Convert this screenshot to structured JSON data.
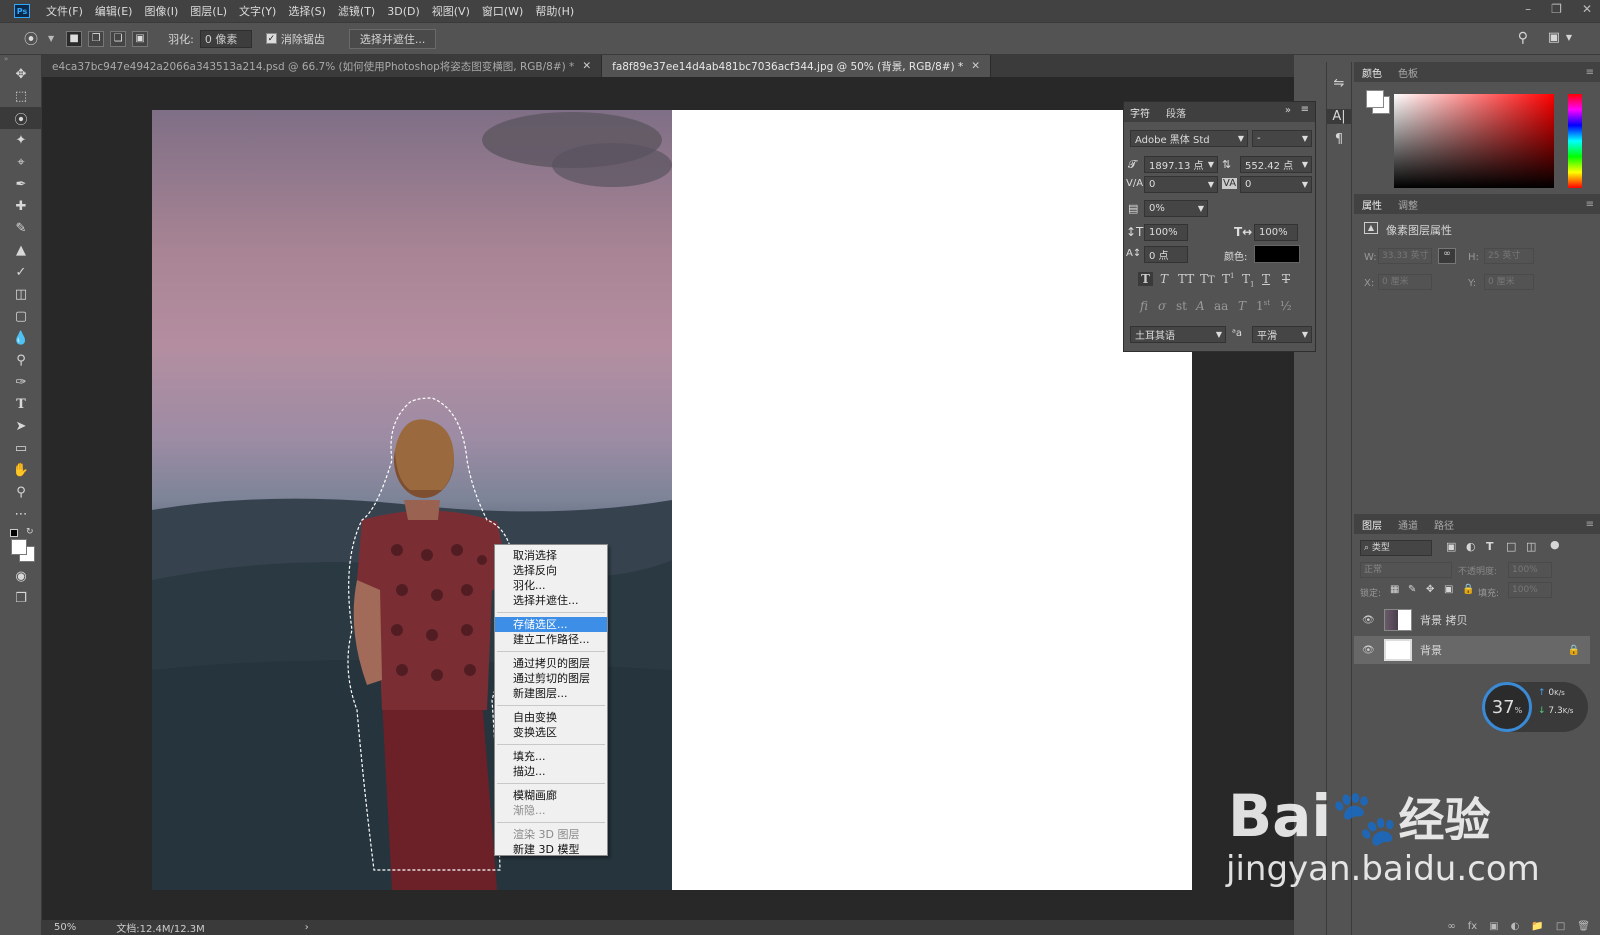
{
  "app": {
    "logo": "Ps"
  },
  "menu": [
    "文件(F)",
    "编辑(E)",
    "图像(I)",
    "图层(L)",
    "文字(Y)",
    "选择(S)",
    "滤镜(T)",
    "3D(D)",
    "视图(V)",
    "窗口(W)",
    "帮助(H)"
  ],
  "options": {
    "feather_label": "羽化:",
    "feather_value": "0 像素",
    "antialias_label": "消除锯齿",
    "antialias_checked": true,
    "select_mask_button": "选择并遮住..."
  },
  "tabs": [
    {
      "title": "e4ca37bc947e4942a2066a343513a214.psd @ 66.7% (如何使用Photoshop将姿态图变横图, RGB/8#) *",
      "active": false
    },
    {
      "title": "fa8f89e37ee14d4ab481bc7036acf344.jpg @ 50% (背景, RGB/8#) *",
      "active": true
    }
  ],
  "context_menu": [
    {
      "label": "取消选择",
      "state": "normal"
    },
    {
      "label": "选择反向",
      "state": "normal"
    },
    {
      "label": "羽化...",
      "state": "normal"
    },
    {
      "label": "选择并遮住...",
      "state": "normal"
    },
    {
      "sep": true
    },
    {
      "label": "存储选区...",
      "state": "highlighted"
    },
    {
      "label": "建立工作路径...",
      "state": "normal"
    },
    {
      "sep": true
    },
    {
      "label": "通过拷贝的图层",
      "state": "normal"
    },
    {
      "label": "通过剪切的图层",
      "state": "normal"
    },
    {
      "label": "新建图层...",
      "state": "normal"
    },
    {
      "sep": true
    },
    {
      "label": "自由变换",
      "state": "normal"
    },
    {
      "label": "变换选区",
      "state": "normal"
    },
    {
      "sep": true
    },
    {
      "label": "填充...",
      "state": "normal"
    },
    {
      "label": "描边...",
      "state": "normal"
    },
    {
      "sep": true
    },
    {
      "label": "模糊画廊",
      "state": "normal"
    },
    {
      "label": "渐隐...",
      "state": "disabled"
    },
    {
      "sep": true
    },
    {
      "label": "渲染 3D 图层",
      "state": "disabled"
    },
    {
      "label": "新建 3D 模型",
      "state": "normal"
    }
  ],
  "character": {
    "tab_char": "字符",
    "tab_para": "段落",
    "font": "Adobe 黑体 Std",
    "style": "-",
    "size": "1897.13 点",
    "leading": "552.42 点",
    "kerning": "0",
    "tracking": "0",
    "tsume": "0%",
    "vscale": "100%",
    "hscale": "100%",
    "baseline": "0 点",
    "color_label": "颜色:",
    "color": "#000000",
    "language": "土耳其语",
    "aa_label": "aₐ",
    "aa": "平滑"
  },
  "color_panel": {
    "tab_color": "颜色",
    "tab_swatch": "色板",
    "fg": "#ffffff",
    "bg": "#ffffff"
  },
  "properties": {
    "tab_props": "属性",
    "tab_adjust": "调整",
    "title": "像素图层属性",
    "w_label": "W:",
    "w": "33.33 英寸",
    "h_label": "H:",
    "h": "25 英寸",
    "x_label": "X:",
    "x": "0 厘米",
    "y_label": "Y:",
    "y": "0 厘米"
  },
  "layers": {
    "tab_layers": "图层",
    "tab_channels": "通道",
    "tab_paths": "路径",
    "kind": "⌕ 类型",
    "blend": "正常",
    "opacity_label": "不透明度:",
    "opacity": "100%",
    "lock_label": "锁定:",
    "fill_label": "填充:",
    "fill": "100%",
    "items": [
      {
        "name": "背景 拷贝",
        "locked": false
      },
      {
        "name": "背景",
        "locked": true
      }
    ]
  },
  "status": {
    "zoom": "50%",
    "doc": "文档:12.4M/12.3M"
  },
  "widget": {
    "percent": "37",
    "unit": "%",
    "up": "0",
    "down": "7.3",
    "rate_unit": "K/s"
  },
  "watermark": {
    "brand": "Bai",
    "brand2": "经验",
    "url": "jingyan.baidu.com"
  }
}
